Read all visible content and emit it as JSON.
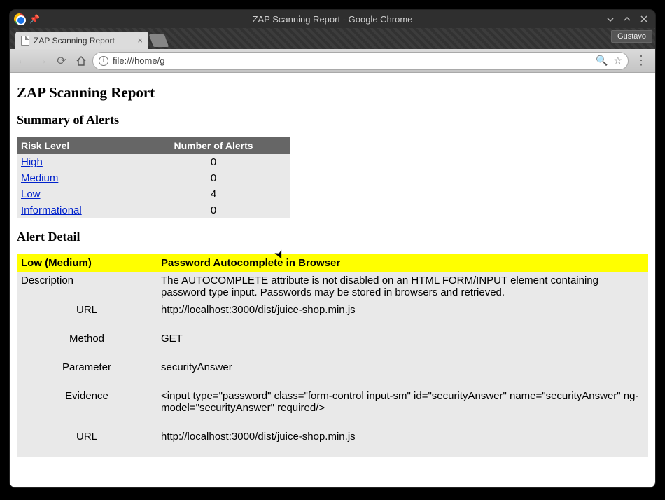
{
  "window": {
    "title": "ZAP Scanning Report - Google Chrome"
  },
  "user": {
    "name": "Gustavo"
  },
  "tab": {
    "title": "ZAP Scanning Report"
  },
  "addressbar": {
    "url": "file:///home/g"
  },
  "page": {
    "h1": "ZAP Scanning Report",
    "summary_heading": "Summary of Alerts",
    "detail_heading": "Alert Detail",
    "summary": {
      "cols": [
        "Risk Level",
        "Number of Alerts"
      ],
      "rows": [
        {
          "label": "High",
          "count": "0"
        },
        {
          "label": "Medium",
          "count": "0"
        },
        {
          "label": "Low",
          "count": "4"
        },
        {
          "label": "Informational",
          "count": "0"
        }
      ]
    },
    "alert": {
      "risk": "Low (Medium)",
      "name": "Password Autocomplete in Browser",
      "rows": [
        {
          "label": "Description",
          "indent": false,
          "value": "The AUTOCOMPLETE attribute is not disabled on an HTML FORM/INPUT element containing password type input. Passwords may be stored in browsers and retrieved."
        },
        {
          "label": "URL",
          "indent": true,
          "value": "http://localhost:3000/dist/juice-shop.min.js"
        },
        {
          "label": "Method",
          "indent": true,
          "value": "GET"
        },
        {
          "label": "Parameter",
          "indent": true,
          "value": "securityAnswer"
        },
        {
          "label": "Evidence",
          "indent": true,
          "value": "<input type=\"password\" class=\"form-control input-sm\" id=\"securityAnswer\" name=\"securityAnswer\" ng-model=\"securityAnswer\" required/>"
        },
        {
          "label": "URL",
          "indent": true,
          "value": "http://localhost:3000/dist/juice-shop.min.js"
        }
      ]
    }
  }
}
